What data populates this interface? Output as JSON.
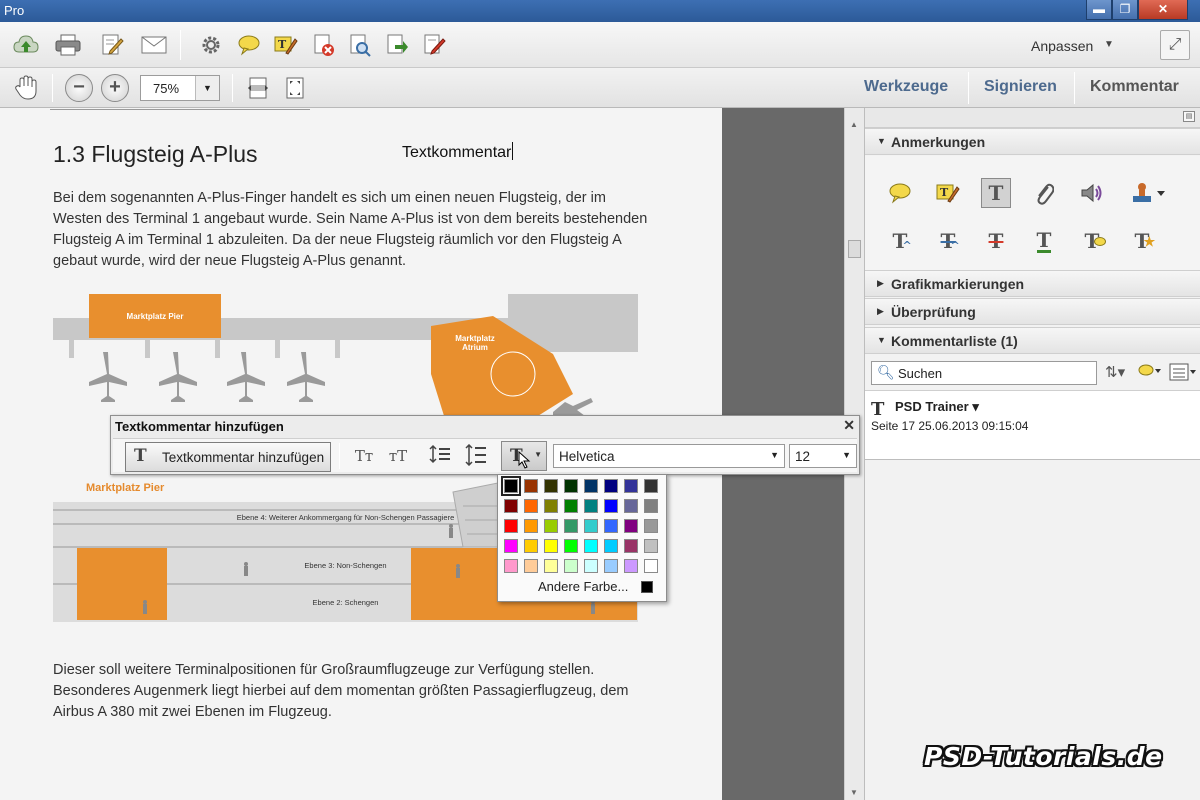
{
  "window": {
    "title": "Pro",
    "min": "▬",
    "max": "❐",
    "close": "✕"
  },
  "toolbar": {
    "anpassen": "Anpassen",
    "anpassen_arrow": "▼",
    "zoom_out": "−",
    "zoom_in": "+",
    "zoom": "75%",
    "zoom_arrow": "▼",
    "panels": [
      "Werkzeuge",
      "Signieren",
      "Kommentar"
    ]
  },
  "document": {
    "heading": "1.3 Flugsteig A-Plus",
    "typed_comment": "Textkommentar",
    "para1": "Bei dem sogenannten A-Plus-Finger handelt es sich um einen neuen Flugsteig, der im Westen des Terminal 1 angebaut wurde. Sein Name A-Plus ist von dem bereits bestehenden Flugsteig A im Terminal 1 abzuleiten. Da der neue Flugsteig räumlich vor den Flugsteig A gebaut wurde, wird der neue Flugsteig A-Plus genannt.",
    "para2": "Dieser soll weitere Terminalpositionen für Großraumflugzeuge zur Verfügung stellen. Besonderes Augenmerk liegt hierbei auf dem momentan größten Passagierflugzeug, dem Airbus A 380 mit zwei Ebenen im Flugzeug.",
    "diagram": {
      "marktplatz_pier": "Marktplatz Pier",
      "marktplatz_atrium": "Marktplatz Atrium",
      "ebene4": "Ebene 4: Weiterer Ankommergang für Non-Schengen Passagiere",
      "ebene3": "Ebene 3: Non-Schengen",
      "ebene2": "Ebene 2: Schengen"
    }
  },
  "textcomment_toolbar": {
    "title": "Textkommentar hinzufügen",
    "close": "✕",
    "add_label": "Textkommentar hinzufügen",
    "font": "Helvetica",
    "size": "12",
    "select_arrow": "▼",
    "color_arrow": "▼"
  },
  "palette": {
    "colors": [
      "#000000",
      "#993300",
      "#333300",
      "#003300",
      "#003366",
      "#000080",
      "#333399",
      "#333333",
      "#800000",
      "#ff6600",
      "#808000",
      "#008000",
      "#008080",
      "#0000ff",
      "#666699",
      "#808080",
      "#ff0000",
      "#ff9900",
      "#99cc00",
      "#339966",
      "#33cccc",
      "#3366ff",
      "#800080",
      "#999999",
      "#ff00ff",
      "#ffcc00",
      "#ffff00",
      "#00ff00",
      "#00ffff",
      "#00ccff",
      "#993366",
      "#c0c0c0",
      "#ff99cc",
      "#ffcc99",
      "#ffff99",
      "#ccffcc",
      "#ccffff",
      "#99ccff",
      "#cc99ff",
      "#ffffff"
    ],
    "selected_index": 0,
    "other_label": "Andere Farbe..."
  },
  "right_panel": {
    "sections": {
      "anmerkungen": "Anmerkungen",
      "grafik": "Grafikmarkierungen",
      "ueberpruefung": "Überprüfung",
      "kommentarliste": "Kommentarliste (1)"
    },
    "search_placeholder": "Suchen",
    "comment": {
      "author": "PSD Trainer",
      "author_arrow": "▾",
      "meta": "Seite 17  25.06.2013 09:15:04"
    }
  },
  "watermark": "PSD-Tutorials.de"
}
